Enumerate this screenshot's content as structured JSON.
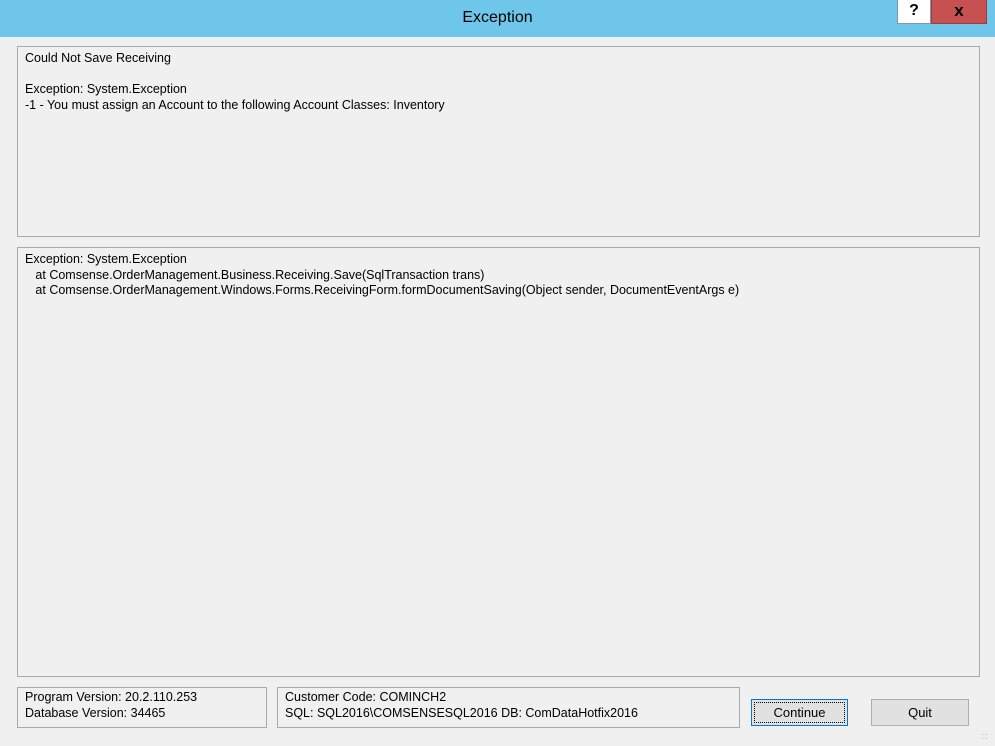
{
  "window": {
    "title": "Exception",
    "help_label": "?",
    "close_label": "x"
  },
  "message": {
    "text": "Could Not Save Receiving\n\nException: System.Exception\n-1 - You must assign an Account to the following Account Classes: Inventory"
  },
  "trace": {
    "text": "Exception: System.Exception\n   at Comsense.OrderManagement.Business.Receiving.Save(SqlTransaction trans)\n   at Comsense.OrderManagement.Windows.Forms.ReceivingForm.formDocumentSaving(Object sender, DocumentEventArgs e)"
  },
  "info": {
    "program_version": "Program Version: 20.2.110.253",
    "database_version": "Database Version: 34465",
    "customer_code": "Customer Code: COMINCH2",
    "sql": "SQL: SQL2016\\COMSENSESQL2016 DB: ComDataHotfix2016"
  },
  "buttons": {
    "continue_label": "Continue",
    "quit_label": "Quit"
  },
  "colors": {
    "titlebar": "#6ec6ea",
    "close": "#c75050",
    "focus_border": "#0078d7"
  }
}
